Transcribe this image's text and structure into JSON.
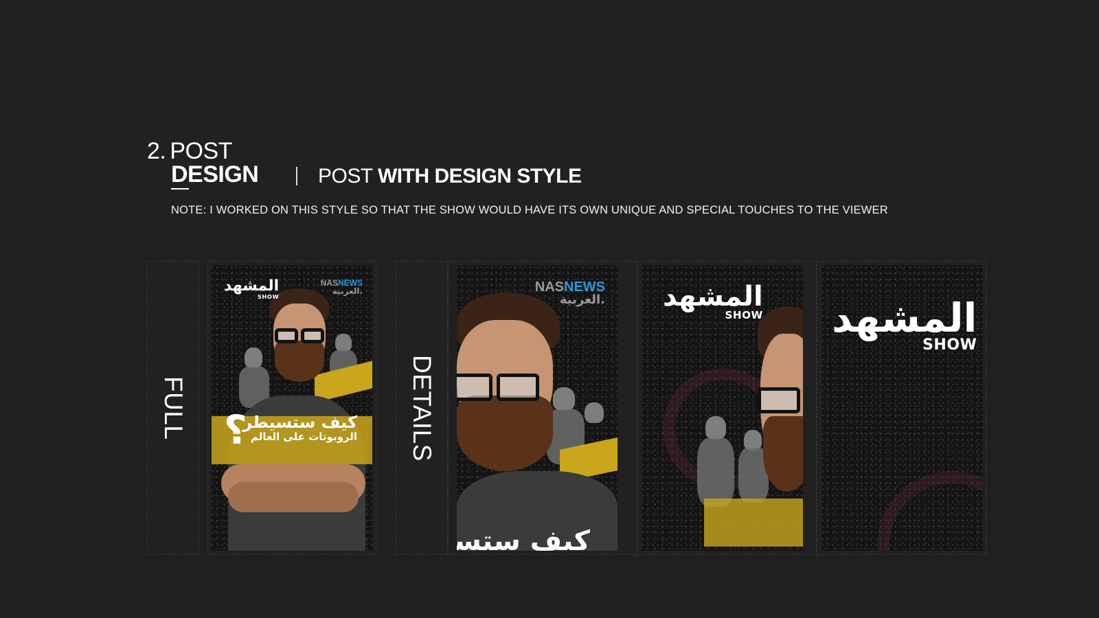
{
  "heading": {
    "number": "2.",
    "post": "POST",
    "design": "DESIGN",
    "subtitle_light": "POST",
    "subtitle_bold": "WITH DESIGN STYLE"
  },
  "note": "NOTE: I WORKED ON THIS STYLE SO THAT THE SHOW WOULD HAVE ITS OWN UNIQUE AND SPECIAL TOUCHES TO THE VIEWER",
  "labels": {
    "full": "FULL",
    "details": "DETAILS"
  },
  "post": {
    "logo_main": "المشهد",
    "logo_sub": "SHOW",
    "nas_gray": "NAS",
    "nas_blue": "NEWS",
    "nas_arabic": "العربية.",
    "headline_line1": "كيف ستسيطر",
    "headline_line2": "الروبوتات على العالم",
    "question_mark": "؟",
    "detail_fragment": "كيف ستسيطر"
  },
  "colors": {
    "background": "#212121",
    "accent_yellow": "#c9a61c",
    "nas_blue": "#2b9ad8"
  }
}
